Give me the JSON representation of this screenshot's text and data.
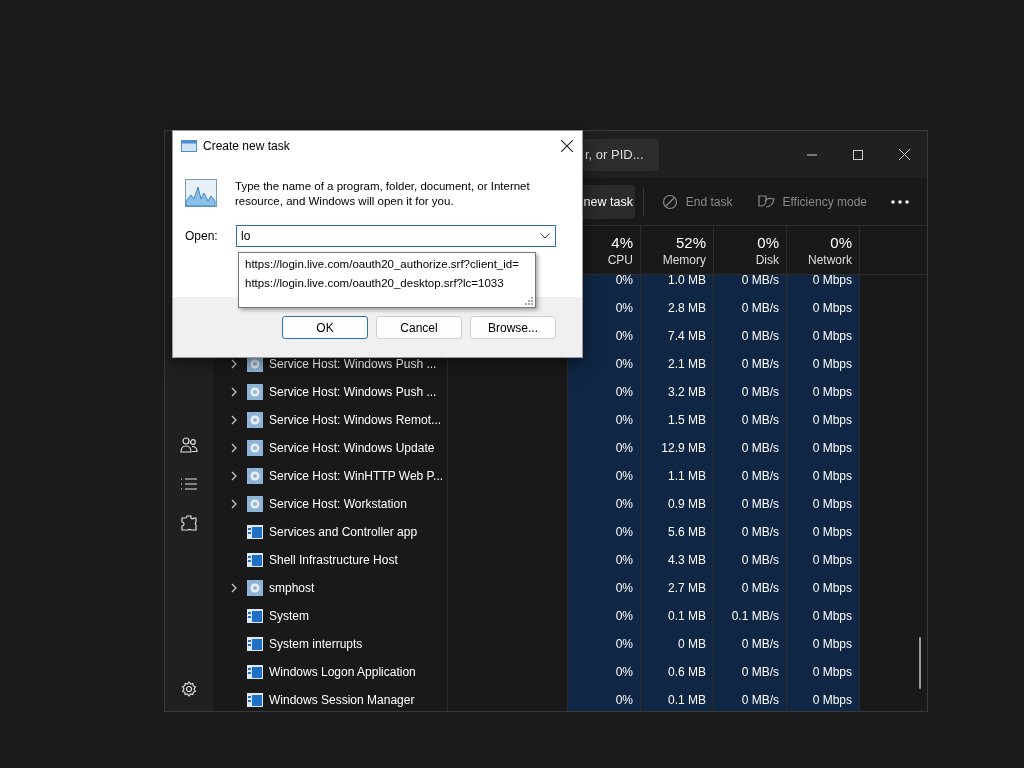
{
  "task_manager": {
    "search": {
      "placeholder": "r, or PID..."
    },
    "toolbar": [
      {
        "kind": "run",
        "label": "new task",
        "disabled": false
      },
      {
        "kind": "end",
        "label": "End task",
        "disabled": true
      },
      {
        "kind": "efficiency",
        "label": "Efficiency mode",
        "disabled": true
      },
      {
        "kind": "more"
      }
    ],
    "sidebar": [
      {
        "kind": "users"
      },
      {
        "kind": "details"
      },
      {
        "kind": "services"
      },
      {
        "kind": "settings"
      }
    ],
    "columns": [
      {
        "percent": "4%",
        "label": "CPU"
      },
      {
        "percent": "52%",
        "label": "Memory"
      },
      {
        "percent": "0%",
        "label": "Disk"
      },
      {
        "percent": "0%",
        "label": "Network"
      }
    ],
    "rows": [
      {
        "cpu": "0%",
        "memory": "1.0 MB",
        "disk": "0 MB/s",
        "network": "0 Mbps"
      },
      {
        "cpu": "0%",
        "memory": "2.8 MB",
        "disk": "0 MB/s",
        "network": "0 Mbps"
      },
      {
        "cpu": "0%",
        "memory": "7.4 MB",
        "disk": "0 MB/s",
        "network": "0 Mbps"
      },
      {
        "name": "Service Host: Windows Push ...",
        "kind": "service",
        "expandable": true,
        "cpu": "0%",
        "memory": "2.1 MB",
        "disk": "0 MB/s",
        "network": "0 Mbps"
      },
      {
        "name": "Service Host: Windows Push ...",
        "kind": "service",
        "expandable": true,
        "cpu": "0%",
        "memory": "3.2 MB",
        "disk": "0 MB/s",
        "network": "0 Mbps"
      },
      {
        "name": "Service Host: Windows Remot...",
        "kind": "service",
        "expandable": true,
        "cpu": "0%",
        "memory": "1.5 MB",
        "disk": "0 MB/s",
        "network": "0 Mbps"
      },
      {
        "name": "Service Host: Windows Update",
        "kind": "service",
        "expandable": true,
        "cpu": "0%",
        "memory": "12.9 MB",
        "disk": "0 MB/s",
        "network": "0 Mbps"
      },
      {
        "name": "Service Host: WinHTTP Web P...",
        "kind": "service",
        "expandable": true,
        "cpu": "0%",
        "memory": "1.1 MB",
        "disk": "0 MB/s",
        "network": "0 Mbps"
      },
      {
        "name": "Service Host: Workstation",
        "kind": "service",
        "expandable": true,
        "cpu": "0%",
        "memory": "0.9 MB",
        "disk": "0 MB/s",
        "network": "0 Mbps"
      },
      {
        "name": "Services and Controller app",
        "kind": "app",
        "expandable": false,
        "cpu": "0%",
        "memory": "5.6 MB",
        "disk": "0 MB/s",
        "network": "0 Mbps"
      },
      {
        "name": "Shell Infrastructure Host",
        "kind": "app",
        "expandable": false,
        "cpu": "0%",
        "memory": "4.3 MB",
        "disk": "0 MB/s",
        "network": "0 Mbps"
      },
      {
        "name": "smphost",
        "kind": "service",
        "expandable": true,
        "cpu": "0%",
        "memory": "2.7 MB",
        "disk": "0 MB/s",
        "network": "0 Mbps"
      },
      {
        "name": "System",
        "kind": "app",
        "expandable": false,
        "cpu": "0%",
        "memory": "0.1 MB",
        "disk": "0.1 MB/s",
        "network": "0 Mbps"
      },
      {
        "name": "System interrupts",
        "kind": "app",
        "expandable": false,
        "cpu": "0%",
        "memory": "0 MB",
        "disk": "0 MB/s",
        "network": "0 Mbps"
      },
      {
        "name": "Windows Logon Application",
        "kind": "app",
        "expandable": false,
        "cpu": "0%",
        "memory": "0.6 MB",
        "disk": "0 MB/s",
        "network": "0 Mbps"
      },
      {
        "name": "Windows Session Manager",
        "kind": "app",
        "expandable": false,
        "cpu": "0%",
        "memory": "0.1 MB",
        "disk": "0 MB/s",
        "network": "0 Mbps"
      }
    ]
  },
  "dialog": {
    "title": "Create new task",
    "message": "Type the name of a program, folder, document, or Internet resource, and Windows will open it for you.",
    "open_label": "Open:",
    "open_value": "lo",
    "suggestions": [
      "https://login.live.com/oauth20_authorize.srf?client_id=",
      "https://login.live.com/oauth20_desktop.srf?lc=1033"
    ],
    "buttons": [
      {
        "label": "OK",
        "default": true
      },
      {
        "label": "Cancel",
        "default": false
      },
      {
        "label": "Browse...",
        "default": false
      }
    ]
  }
}
